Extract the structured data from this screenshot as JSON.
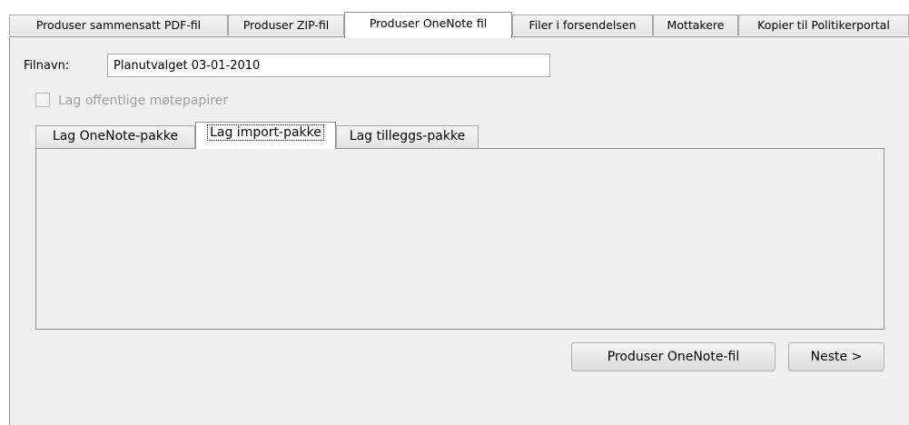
{
  "top_tabs": [
    {
      "label": "Produser sammensatt PDF-fil",
      "active": false
    },
    {
      "label": "Produser ZIP-fil",
      "active": false
    },
    {
      "label": "Produser OneNote fil",
      "active": true
    },
    {
      "label": "Filer i forsendelsen",
      "active": false
    },
    {
      "label": "Mottakere",
      "active": false
    },
    {
      "label": "Kopier til Politikerportal",
      "active": false
    }
  ],
  "filename": {
    "label": "Filnavn:",
    "value": "Planutvalget 03-01-2010"
  },
  "public_papers_checkbox": {
    "label": "Lag offentlige møtepapirer",
    "checked": false,
    "disabled": true
  },
  "inner_tabs": [
    {
      "label": "Lag OneNote-pakke",
      "active": false
    },
    {
      "label": "Lag import-pakke",
      "active": true
    },
    {
      "label": "Lag tilleggs-pakke",
      "active": false
    }
  ],
  "buttons": {
    "produce_onenote": "Produser OneNote-fil",
    "next": "Neste >"
  }
}
